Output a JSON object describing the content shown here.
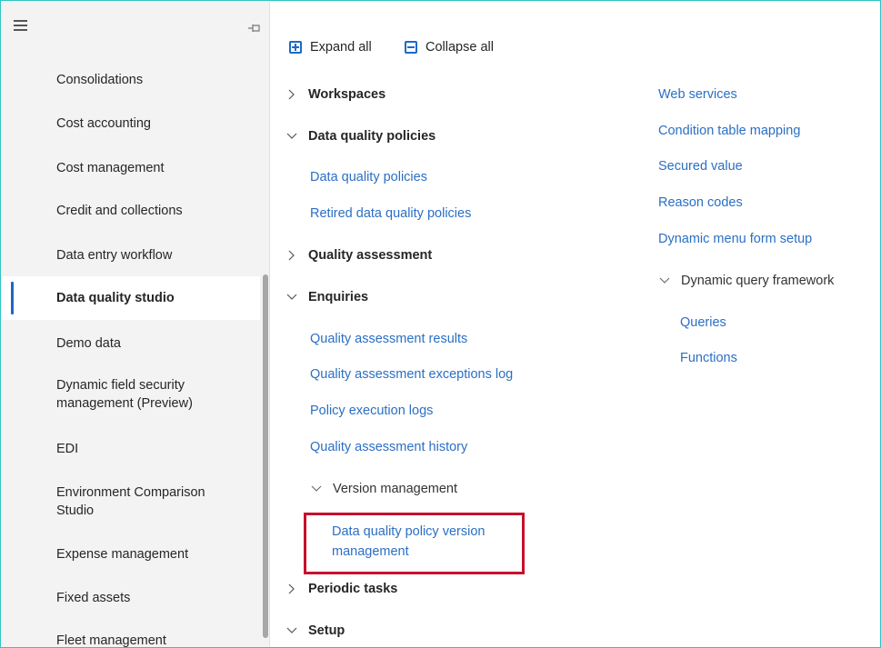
{
  "sidebar": {
    "items": [
      {
        "label": "Consolidations"
      },
      {
        "label": "Cost accounting"
      },
      {
        "label": "Cost management"
      },
      {
        "label": "Credit and collections"
      },
      {
        "label": "Data entry workflow"
      },
      {
        "label": "Data quality studio",
        "selected": true
      },
      {
        "label": "Demo data"
      },
      {
        "label": "Dynamic field security management (Preview)"
      },
      {
        "label": "EDI"
      },
      {
        "label": "Environment Comparison Studio"
      },
      {
        "label": "Expense management"
      },
      {
        "label": "Fixed assets"
      },
      {
        "label": "Fleet management"
      }
    ],
    "item_lines": {
      "dyn_line1": "Dynamic field security",
      "dyn_line2": "management (Preview)",
      "env_line1": "Environment Comparison",
      "env_line2": "Studio"
    }
  },
  "toolbar": {
    "expand_all": "Expand all",
    "collapse_all": "Collapse all"
  },
  "left_column": {
    "workspaces": "Workspaces",
    "dq_policies_header": "Data quality policies",
    "dq_policies_link": "Data quality policies",
    "retired_link": "Retired data quality policies",
    "quality_assessment": "Quality assessment",
    "enquiries": "Enquiries",
    "qa_results": "Quality assessment results",
    "qa_exceptions": "Quality assessment exceptions log",
    "policy_exec_logs": "Policy execution logs",
    "qa_history": "Quality assessment history",
    "version_mgmt": "Version management",
    "dq_version_line1": "Data quality policy version",
    "dq_version_line2": "management",
    "periodic_tasks": "Periodic tasks",
    "setup": "Setup"
  },
  "right_column": {
    "web_services": "Web services",
    "condition_table": "Condition table mapping",
    "secured_value": "Secured value",
    "reason_codes": "Reason codes",
    "dynamic_menu": "Dynamic menu form setup",
    "dynamic_query": "Dynamic query framework",
    "queries": "Queries",
    "functions": "Functions"
  },
  "colors": {
    "accent": "#1b6ac9",
    "link": "#2b6fc4",
    "highlight_border": "#c8102e",
    "frame_border": "#2ec4c4"
  },
  "icons": [
    "hamburger-icon",
    "pin-icon",
    "expand-all-icon",
    "collapse-all-icon",
    "chevron-right-icon",
    "chevron-down-icon"
  ]
}
